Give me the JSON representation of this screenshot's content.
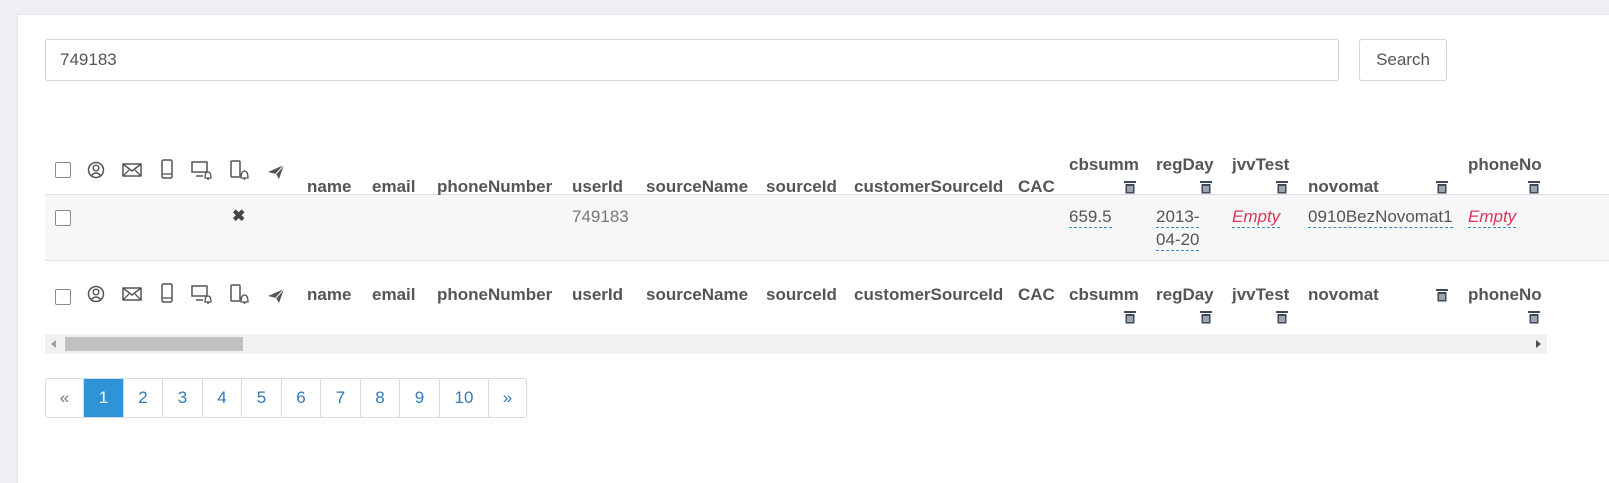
{
  "search": {
    "value": "749183",
    "button_label": "Search"
  },
  "columns": [
    "name",
    "email",
    "phoneNumber",
    "userId",
    "sourceName",
    "sourceId",
    "customerSourceId",
    "CAC",
    "cbsumm",
    "regDay",
    "jvvTest",
    "novomat",
    "phoneNo"
  ],
  "icons": [
    "user-circle-icon",
    "envelope-icon",
    "mobile-phone-icon",
    "desktop-bell-icon",
    "mobile-bell-icon",
    "paper-plane-icon"
  ],
  "row": {
    "status_mark": "✖",
    "userId": "749183",
    "cbsumm": "659.5",
    "regDay_line1": "2013-",
    "regDay_line2": "04-20",
    "jvvTest": "Empty",
    "novomat": "0910BezNovomat1",
    "phoneNo": "Empty"
  },
  "pagination": {
    "prev": "«",
    "pages": [
      "1",
      "2",
      "3",
      "4",
      "5",
      "6",
      "7",
      "8",
      "9",
      "10"
    ],
    "next": "»",
    "active": "1"
  },
  "colors": {
    "active_page": "#3093d8",
    "link": "#337ab7",
    "empty": "#d9355b"
  }
}
